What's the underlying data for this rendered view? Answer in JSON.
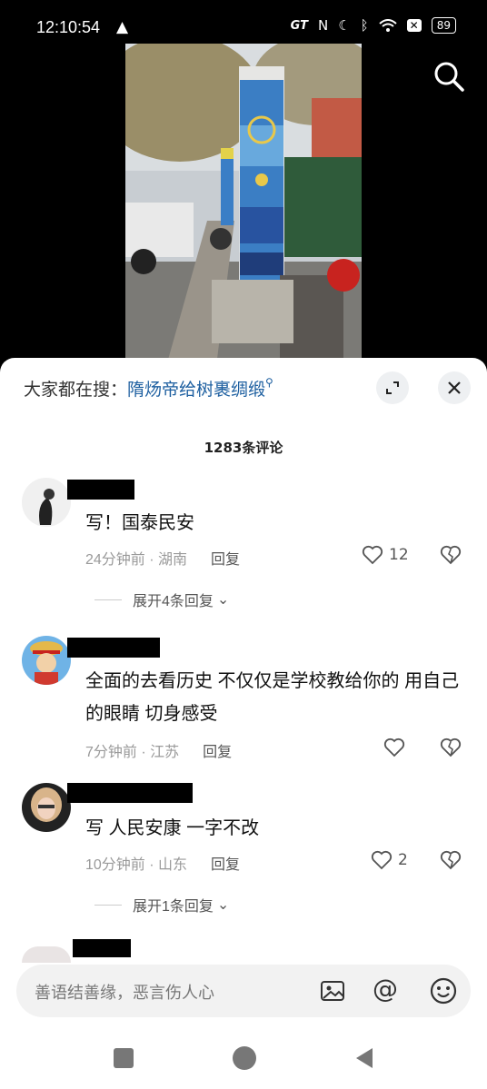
{
  "status_bar": {
    "time": "12:10:54",
    "net_label": "GT",
    "battery": "89",
    "icons": [
      "warning-icon",
      "nfc-icon",
      "moon-icon",
      "bluetooth-icon",
      "wifi-icon",
      "x-icon",
      "battery-icon"
    ]
  },
  "search": {
    "icon": "search-icon"
  },
  "hot_search": {
    "prefix": "大家都在搜：",
    "keyword": "隋炀帝给树裹绸缎"
  },
  "comments_header": {
    "count_label": "1283条评论"
  },
  "comments": [
    {
      "text": "写！国泰民安",
      "meta": "24分钟前 · 湖南",
      "reply": "回复",
      "likes": "12",
      "expand": "展开4条回复"
    },
    {
      "text": "全面的去看历史 不仅仅是学校教给你的 用自己的眼睛 切身感受",
      "meta": "7分钟前 · 江苏",
      "reply": "回复",
      "likes": ""
    },
    {
      "text": "写 人民安康 一字不改",
      "meta": "10分钟前 · 山东",
      "reply": "回复",
      "likes": "2",
      "expand": "展开1条回复"
    }
  ],
  "input": {
    "placeholder": "善语结善缘，恶言伤人心"
  },
  "colors": {
    "keyword": "#1d5fa0",
    "sheet_bg": "#ffffff",
    "input_bg": "#f2f2f2"
  }
}
